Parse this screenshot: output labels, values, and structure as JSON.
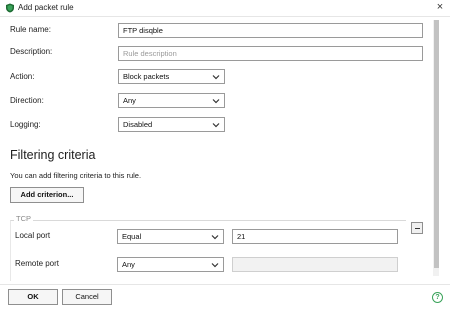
{
  "window": {
    "title": "Add packet rule",
    "close_glyph": "×"
  },
  "form": {
    "rule_name_label": "Rule name:",
    "rule_name_value": "FTP disqble",
    "description_label": "Description:",
    "description_placeholder": "Rule description",
    "action_label": "Action:",
    "action_value": "Block packets",
    "direction_label": "Direction:",
    "direction_value": "Any",
    "logging_label": "Logging:",
    "logging_value": "Disabled"
  },
  "filtering": {
    "title": "Filtering criteria",
    "info": "You can add filtering criteria to this rule.",
    "add_button": "Add criterion..."
  },
  "tcp": {
    "group_title": "TCP",
    "local_port_label": "Local port",
    "local_port_operator": "Equal",
    "local_port_value": "21",
    "remote_port_label": "Remote port",
    "remote_port_operator": "Any",
    "remote_port_value": ""
  },
  "footer": {
    "ok": "OK",
    "cancel": "Cancel",
    "help_glyph": "?"
  },
  "colors": {
    "accent_green": "#3aa35a",
    "shield_dark": "#1e6b33"
  },
  "icons": [
    "shield-app-icon",
    "close-icon",
    "chevron-down-icon",
    "minus-icon",
    "help-icon"
  ]
}
